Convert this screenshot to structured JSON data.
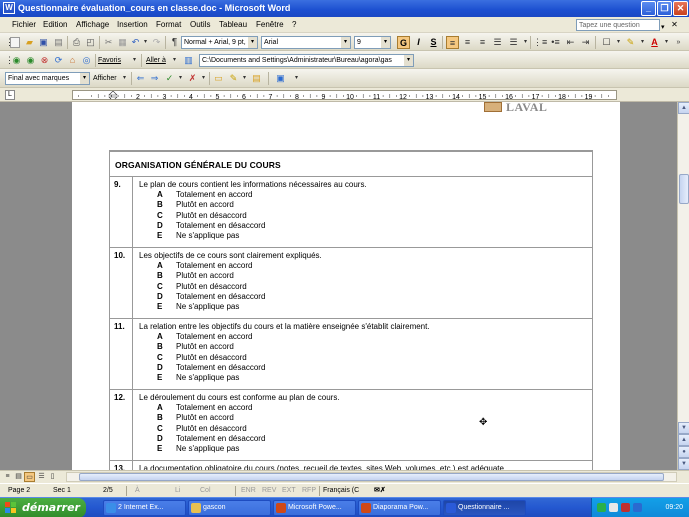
{
  "window": {
    "title": "Questionnaire évaluation_cours en classe.doc - Microsoft Word",
    "app_icon": "W"
  },
  "menu": {
    "items": [
      "Fichier",
      "Edition",
      "Affichage",
      "Insertion",
      "Format",
      "Outils",
      "Tableau",
      "Fenêtre",
      "?"
    ],
    "ask_placeholder": "Tapez une question"
  },
  "formatting": {
    "style": "Normal + Arial, 9 pt,",
    "font": "Arial",
    "size": "9",
    "bold": "G",
    "italic": "I",
    "underline": "S"
  },
  "web_toolbar": {
    "favorites": "Favoris",
    "goto": "Aller à",
    "address": "C:\\Documents and Settings\\Administrateur\\Bureau\\agora\\gas"
  },
  "review_toolbar": {
    "view": "Final avec marques",
    "show": "Afficher"
  },
  "ruler": {
    "labels": [
      "1",
      "2",
      "3",
      "4",
      "5",
      "6",
      "7",
      "8",
      "9",
      "10",
      "11",
      "12",
      "13",
      "14",
      "15",
      "16",
      "17",
      "18",
      "19"
    ]
  },
  "document": {
    "logo_text": "LAVAL",
    "section_title": "ORGANISATION GÉNÉRALE DU COURS",
    "options": [
      {
        "letter": "A",
        "text": "Totalement en accord"
      },
      {
        "letter": "B",
        "text": "Plutôt en accord"
      },
      {
        "letter": "C",
        "text": "Plutôt en désaccord"
      },
      {
        "letter": "D",
        "text": "Totalement en désaccord"
      },
      {
        "letter": "E",
        "text": "Ne s'applique pas"
      }
    ],
    "questions": [
      {
        "number": "9.",
        "text": "Le plan de cours contient les informations nécessaires au cours."
      },
      {
        "number": "10.",
        "text": "Les objectifs de ce cours sont clairement expliqués."
      },
      {
        "number": "11.",
        "text": "La relation entre les objectifs du cours et la matière enseignée s'établit clairement."
      },
      {
        "number": "12.",
        "text": "Le déroulement du cours est conforme au plan de cours."
      },
      {
        "number": "13.",
        "text": "La documentation obligatoire du cours (notes, recueil de textes, sites Web, volumes, etc.) est adéquate."
      }
    ]
  },
  "status": {
    "page": "Page 2",
    "section": "Sec 1",
    "pages": "2/5",
    "at": "À",
    "line": "Li",
    "col": "Col",
    "enr": "ENR",
    "rev": "REV",
    "ext": "EXT",
    "rfp": "RFP",
    "language": "Français (C"
  },
  "taskbar": {
    "start": "démarrer",
    "buttons": [
      {
        "label": "2 Internet Ex...",
        "icon": "ie-icon",
        "color": "#3a8ee8"
      },
      {
        "label": "gascon",
        "icon": "folder-icon",
        "color": "#e8c050"
      },
      {
        "label": "Microsoft Powe...",
        "icon": "powerpoint-icon",
        "color": "#d04818"
      },
      {
        "label": "Diaporama Pow...",
        "icon": "powerpoint-icon",
        "color": "#d04818"
      },
      {
        "label": "Questionnaire ...",
        "icon": "word-icon",
        "color": "#2a5ad8"
      }
    ],
    "clock": "09:20"
  }
}
